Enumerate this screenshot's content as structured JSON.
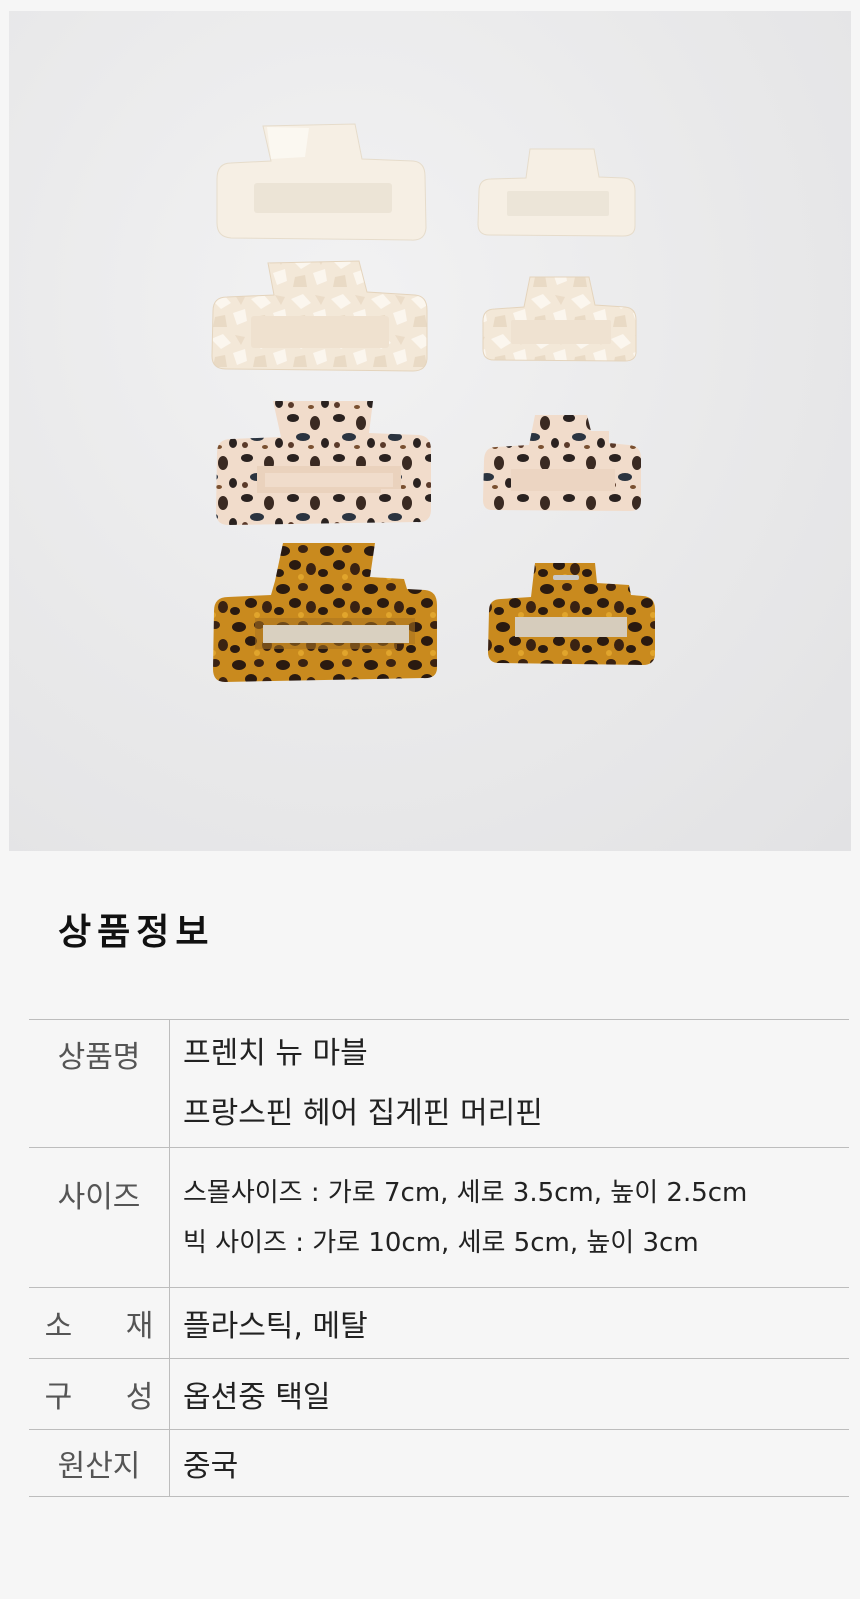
{
  "title": "상품정보",
  "rows": [
    {
      "label": "상품명",
      "lines": [
        "프렌치 뉴 마블",
        "프랑스핀 헤어 집게핀 머리핀"
      ]
    },
    {
      "label": "사이즈",
      "lines": [
        "스몰사이즈 : 가로 7cm, 세로 3.5cm, 높이 2.5cm",
        "빅 사이즈 : 가로 10cm, 세로 5cm, 높이 3cm"
      ]
    },
    {
      "label": "소 재",
      "lines": [
        "플라스틱, 메탈"
      ]
    },
    {
      "label": "구 성",
      "lines": [
        "옵션중 택일"
      ]
    },
    {
      "label": "원산지",
      "lines": [
        "중국"
      ]
    }
  ],
  "clips": [
    {
      "name": "cream-solid",
      "colors": {
        "base": "#f6efe4",
        "accent": "#fbf8f1",
        "spots": ""
      }
    },
    {
      "name": "cream-marble",
      "colors": {
        "base": "#f3e8d8",
        "accent": "#fbf5ec",
        "spots": ""
      }
    },
    {
      "name": "blonde-tortoise",
      "colors": {
        "base": "#f1dccb",
        "accent": "#e7c6ad",
        "spots": "#2a2220"
      }
    },
    {
      "name": "amber-tortoise",
      "colors": {
        "base": "#c98a1e",
        "accent": "#e1a52c",
        "spots": "#2a1a10"
      }
    }
  ]
}
